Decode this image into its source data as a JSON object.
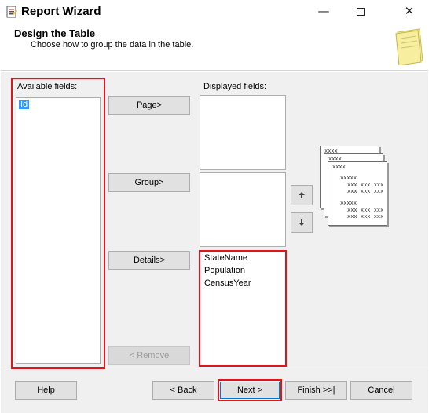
{
  "window": {
    "title": "Report Wizard",
    "minimize_glyph": "—",
    "maximize_glyph": "☐",
    "close_glyph": "✕"
  },
  "header": {
    "title": "Design the Table",
    "subtitle": "Choose how to group the data in the table."
  },
  "available_fields": {
    "label": "Available fields:",
    "items": [
      "Id"
    ],
    "selected_item": "Id"
  },
  "displayed_fields": {
    "label": "Displayed fields:",
    "page_items": [],
    "group_items": [],
    "detail_items": [
      "StateName",
      "Population",
      "CensusYear"
    ]
  },
  "buttons": {
    "page": "Page>",
    "group": "Group>",
    "details": "Details>",
    "remove": "< Remove",
    "move_up": "🡅",
    "move_down": "🡇"
  },
  "preview": {
    "header1": "xxxx",
    "header2": "xxxx",
    "header3": "xxxx",
    "group_row": "xxxxx",
    "detail_row": "xxx xxx xxx"
  },
  "footer": {
    "help": "Help",
    "back": "< Back",
    "next": "Next >",
    "finish": "Finish >>|",
    "cancel": "Cancel"
  },
  "colors": {
    "highlight_border": "#e3131c",
    "selection": "#3399ff"
  }
}
